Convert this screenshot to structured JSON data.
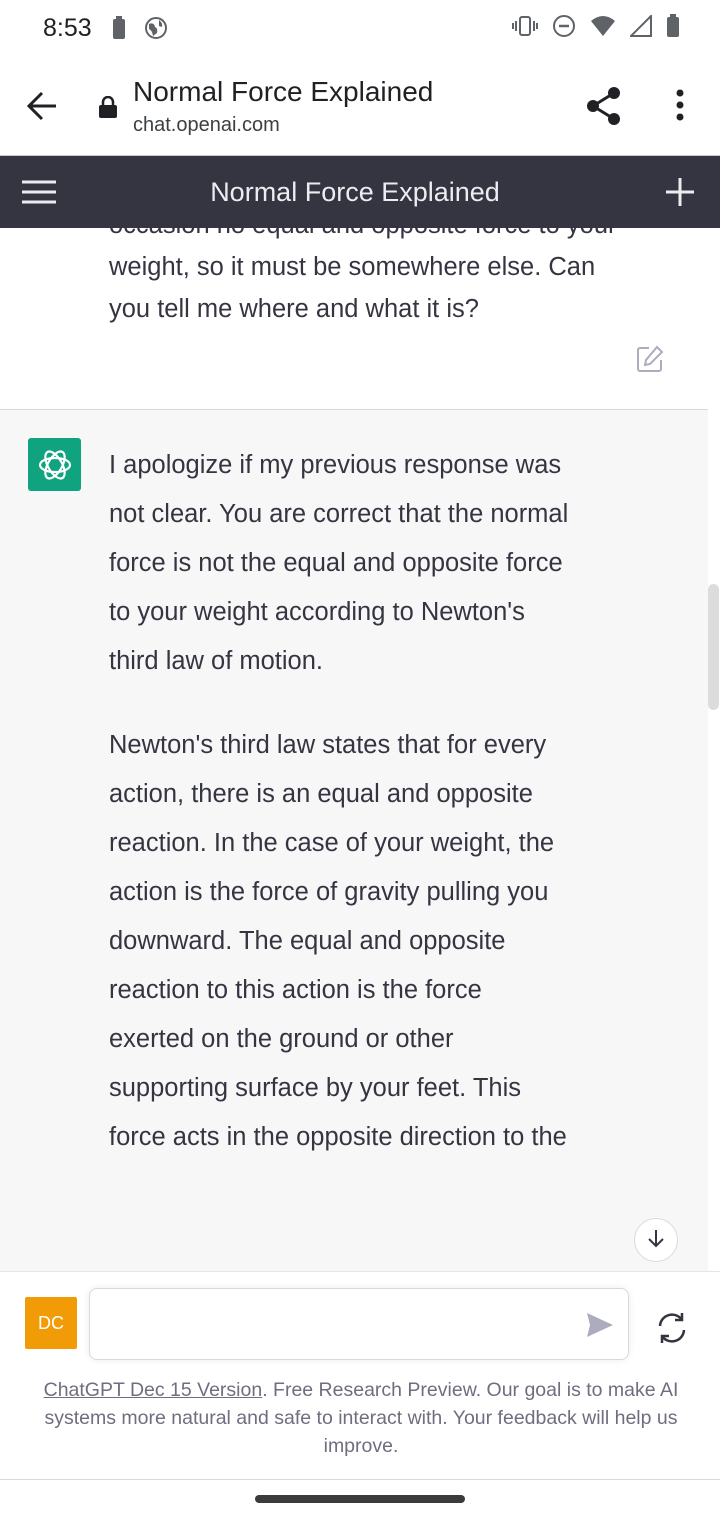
{
  "status_bar": {
    "time": "8:53"
  },
  "browser": {
    "title": "Normal Force Explained",
    "url": "chat.openai.com"
  },
  "chat_header": {
    "title": "Normal Force Explained"
  },
  "conversation": {
    "user_message": "occasion no equal and opposite force to your weight, so it must be somewhere else. Can you tell me where and what it is?",
    "assistant_paragraphs": [
      "I apologize if my previous response was not clear. You are correct that the normal force is not the equal and opposite force to your weight according to Newton's third law of motion.",
      "Newton's third law states that for every action, there is an equal and opposite reaction. In the case of your weight, the action is the force of gravity pulling you downward. The equal and opposite reaction to this action is the force exerted on the ground or other supporting surface by your feet. This force acts in the opposite direction to the"
    ]
  },
  "input": {
    "user_avatar": "DC",
    "value": "",
    "placeholder": ""
  },
  "footer": {
    "version_link": "ChatGPT Dec 15 Version",
    "note": ". Free Research Preview. Our goal is to make AI systems more natural and safe to interact with. Your feedback will help us improve."
  },
  "colors": {
    "header_bg": "#343541",
    "assistant_bg": "#f7f7f8",
    "brand_green": "#10a37f",
    "user_avatar_bg": "#f19b07"
  }
}
